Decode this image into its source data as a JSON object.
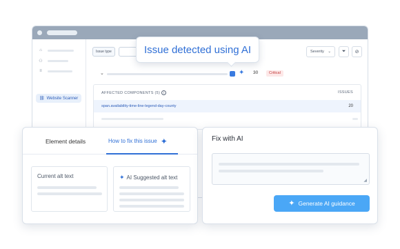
{
  "app": {
    "sidebar": {
      "active_item": {
        "label": "Website Scanner",
        "icon": "link-icon"
      }
    },
    "toolbar": {
      "filter_chip": "Issue type",
      "severity_select": "Severity",
      "filter_icon": "filter-icon",
      "hide_icon": "eye-off-icon"
    },
    "issue": {
      "count": "30",
      "severity_badge": "Critical"
    },
    "components": {
      "header_left": "AFFECTED COMPONENTS (5)",
      "header_right": "ISSUES",
      "rows": [
        {
          "name": "span.availability-time-line-legend-day-county",
          "count": "20"
        }
      ]
    }
  },
  "tooltip": {
    "text": "Issue detected using AI"
  },
  "left_card": {
    "tabs": [
      {
        "label": "Element details"
      },
      {
        "label": "How to fix this issue"
      }
    ],
    "current_alt": {
      "title": "Current alt text"
    },
    "ai_alt": {
      "title": "AI Suggested alt text"
    }
  },
  "right_card": {
    "title": "Fix with AI",
    "button": "Generate AI guidance"
  },
  "colors": {
    "accent": "#2f6fd6",
    "button": "#4aa7f6",
    "critical": "#c23b3b"
  }
}
